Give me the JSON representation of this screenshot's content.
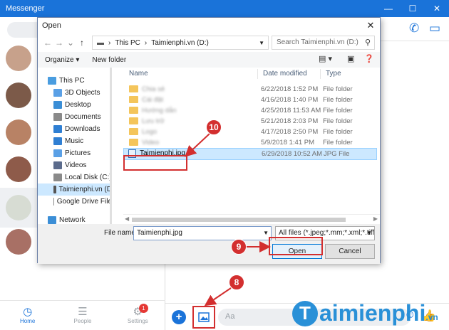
{
  "app": {
    "title": "Messenger"
  },
  "window_controls": {
    "minimize": "—",
    "maximize": "☐",
    "close": "✕"
  },
  "left_nav": {
    "home": "Home",
    "people": "People",
    "settings": "Settings",
    "settings_badge": "1"
  },
  "composer": {
    "placeholder": "Aa"
  },
  "dialog": {
    "title": "Open",
    "breadcrumb": [
      "This PC",
      "Taimienphi.vn (D:)"
    ],
    "search_placeholder": "Search Taimienphi.vn (D:)",
    "toolbar": {
      "organize": "Organize",
      "new_folder": "New folder"
    },
    "nav_tree": [
      {
        "label": "This PC",
        "icon": "computer-icon",
        "color": "#4a9de0"
      },
      {
        "label": "3D Objects",
        "icon": "cube-icon",
        "color": "#5aa0e6"
      },
      {
        "label": "Desktop",
        "icon": "desktop-icon",
        "color": "#3b8ed6"
      },
      {
        "label": "Documents",
        "icon": "document-icon",
        "color": "#8a8a8a"
      },
      {
        "label": "Downloads",
        "icon": "download-icon",
        "color": "#2f7fd3"
      },
      {
        "label": "Music",
        "icon": "music-icon",
        "color": "#2f7fd3"
      },
      {
        "label": "Pictures",
        "icon": "picture-icon",
        "color": "#5aa0e6"
      },
      {
        "label": "Videos",
        "icon": "video-icon",
        "color": "#5b6b8c"
      },
      {
        "label": "Local Disk (C:)",
        "icon": "drive-icon",
        "color": "#8a8a8a"
      },
      {
        "label": "Taimienphi.vn (D",
        "icon": "drive-icon",
        "color": "#555"
      },
      {
        "label": "Google Drive File",
        "icon": "drive-icon",
        "color": "#8a8a8a"
      },
      {
        "label": "Network",
        "icon": "network-icon",
        "color": "#3b8ed6"
      }
    ],
    "columns": {
      "name": "Name",
      "date": "Date modified",
      "type": "Type"
    },
    "files": [
      {
        "name": "Chia sẻ",
        "date": "6/22/2018 1:52 PM",
        "type": "File folder"
      },
      {
        "name": "Cái đặt",
        "date": "4/16/2018 1:40 PM",
        "type": "File folder"
      },
      {
        "name": "Hướng dẫn",
        "date": "4/25/2018 11:53 AM",
        "type": "File folder"
      },
      {
        "name": "Lưu trữ",
        "date": "5/21/2018 2:03 PM",
        "type": "File folder"
      },
      {
        "name": "Logo",
        "date": "4/17/2018 2:50 PM",
        "type": "File folder"
      },
      {
        "name": "Video",
        "date": "5/9/2018 1:41 PM",
        "type": "File folder"
      },
      {
        "name": "Taimienphi.jpg",
        "date": "6/29/2018 10:52 AM",
        "type": "JPG File"
      }
    ],
    "file_name_label": "File name:",
    "file_name_value": "Taimienphi.jpg",
    "file_type_value": "All files (*.jpeg;*.mm;*.xml;*.tiff",
    "open_label": "Open",
    "cancel_label": "Cancel"
  },
  "steps": {
    "step8": "8",
    "step9": "9",
    "step10": "10"
  },
  "watermark": {
    "text": "aimienphi",
    "suffix": ".vn",
    "logo_letter": "T"
  }
}
